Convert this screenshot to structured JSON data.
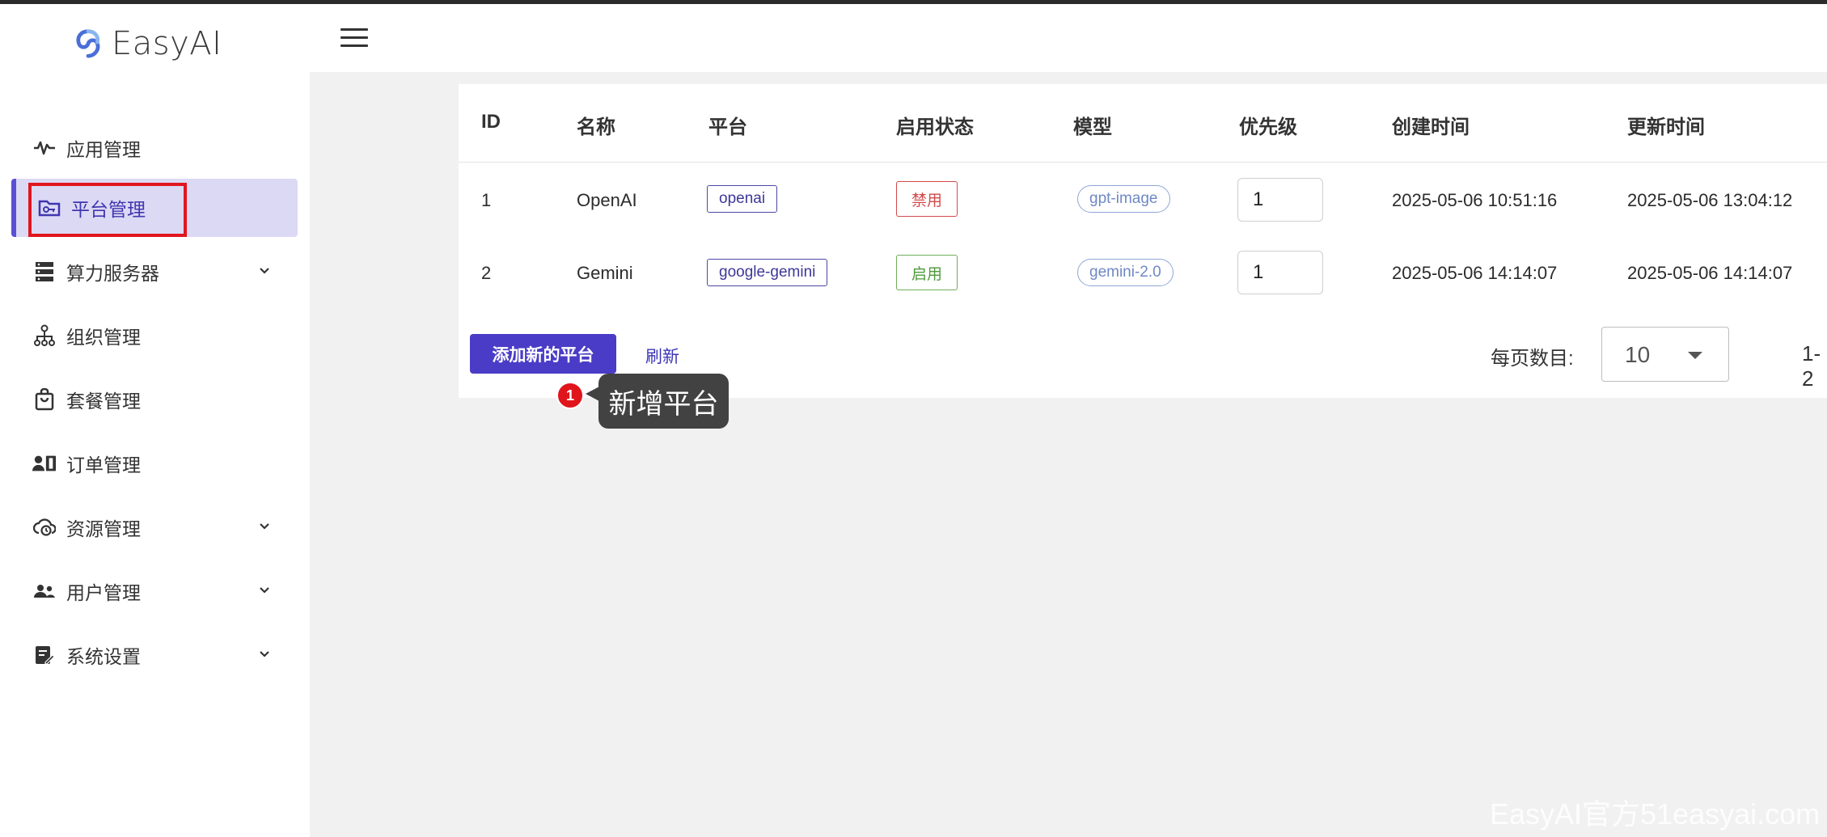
{
  "app": {
    "name": "EasyAI"
  },
  "sidebar": {
    "items": [
      {
        "label": "应用管理",
        "icon": "activity-icon",
        "expandable": false
      },
      {
        "label": "平台管理",
        "icon": "folder-key-icon",
        "expandable": false,
        "active": true
      },
      {
        "label": "算力服务器",
        "icon": "server-icon",
        "expandable": true
      },
      {
        "label": "组织管理",
        "icon": "org-tree-icon",
        "expandable": false
      },
      {
        "label": "套餐管理",
        "icon": "shopping-bag-icon",
        "expandable": false
      },
      {
        "label": "订单管理",
        "icon": "order-badge-icon",
        "expandable": false
      },
      {
        "label": "资源管理",
        "icon": "cloud-clock-icon",
        "expandable": true
      },
      {
        "label": "用户管理",
        "icon": "users-icon",
        "expandable": true
      },
      {
        "label": "系统设置",
        "icon": "settings-doc-icon",
        "expandable": true
      }
    ]
  },
  "table": {
    "headers": [
      "ID",
      "名称",
      "平台",
      "启用状态",
      "模型",
      "优先级",
      "创建时间",
      "更新时间"
    ],
    "rows": [
      {
        "id": "1",
        "name": "OpenAI",
        "platform": "openai",
        "status": "禁用",
        "status_color": "#d24a4a",
        "model": "gpt-image",
        "priority": "1",
        "created": "2025-05-06 10:51:16",
        "updated": "2025-05-06 13:04:12"
      },
      {
        "id": "2",
        "name": "Gemini",
        "platform": "google-gemini",
        "status": "启用",
        "status_color": "#4e9a3b",
        "model": "gemini-2.0",
        "priority": "1",
        "created": "2025-05-06 14:14:07",
        "updated": "2025-05-06 14:14:07"
      }
    ]
  },
  "actions": {
    "add_label": "添加新的平台",
    "refresh_label": "刷新"
  },
  "pagination": {
    "per_page_label": "每页数目:",
    "per_page_value": "10",
    "range": "1-2"
  },
  "tooltip": {
    "step": "1",
    "text": "新增平台"
  },
  "watermark": "EasyAI官方51easyai.com",
  "colors": {
    "accent": "#4a3cc6",
    "active_bg": "#dcd9f5",
    "highlight": "#e0161f"
  }
}
